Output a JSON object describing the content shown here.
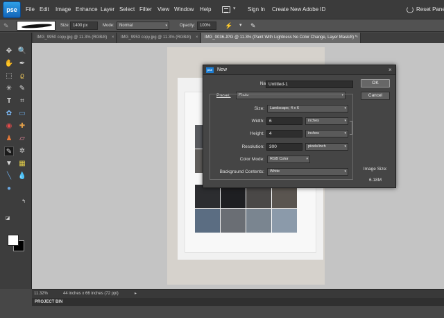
{
  "app": {
    "logo_text": "pse"
  },
  "menu": {
    "items": [
      "File",
      "Edit",
      "Image",
      "Enhance",
      "Layer",
      "Select",
      "Filter",
      "View",
      "Window",
      "Help"
    ],
    "sign_in": "Sign In",
    "create_id": "Create New Adobe ID",
    "reset_panels": "Reset Panels"
  },
  "options": {
    "size_label": "Size:",
    "size_value": "1400 px",
    "mode_label": "Mode:",
    "mode_value": "Normal",
    "opacity_label": "Opacity:",
    "opacity_value": "100%"
  },
  "tabs": [
    {
      "label": "IMG_9950 copy.jpg @ 11.3% (RGB/8)",
      "close": "×"
    },
    {
      "label": "IMG_9953 copy.jpg @ 11.3% (RGB/8)",
      "close": "×"
    },
    {
      "label": "IMG_0036.JPG @ 11.3% (Paint With Lightness No Color Change, Layer Mask/8) *",
      "close": "×"
    }
  ],
  "status": {
    "zoom": "11.32%",
    "doc_size": "44 inches x 66 inches (72 ppi)",
    "project_bin": "PROJECT BIN"
  },
  "dialog": {
    "title": "New",
    "close": "×",
    "name_label": "Name:",
    "name_value": "Untitled-1",
    "preset_label": "Preset:",
    "preset_value": "Photo",
    "size_label": "Size:",
    "size_value": "Landscape, 4 x 6",
    "width_label": "Width:",
    "width_value": "6",
    "width_unit": "inches",
    "height_label": "Height:",
    "height_value": "4",
    "height_unit": "inches",
    "resolution_label": "Resolution:",
    "resolution_value": "300",
    "resolution_unit": "pixels/inch",
    "color_mode_label": "Color Mode:",
    "color_mode_value": "RGB Color",
    "bg_contents_label": "Background Contents:",
    "bg_contents_value": "White",
    "ok": "OK",
    "cancel": "Cancel",
    "image_size_label": "Image Size:",
    "image_size_value": "6.18M"
  },
  "icons": {
    "move": "✥",
    "zoom": "🔍",
    "hand": "✋",
    "eyedropper": "✒",
    "marquee": "⬚",
    "lasso": "ϱ",
    "magic_wand": "✳",
    "quick_select": "✎",
    "type": "T",
    "crop": "⌗",
    "cookie_cutter": "✿",
    "recompose": "▭",
    "red_eye": "◉",
    "healing": "✚",
    "clone": "♟",
    "eraser": "▱",
    "brush": "✎",
    "smart_brush": "✲",
    "paint_bucket": "▼",
    "gradient": "▦",
    "shape": "╲",
    "blur": "💧",
    "sponge": "●",
    "swap": "↰",
    "default_colors": "◪"
  },
  "colors": {
    "accent": "#1e7fd4",
    "chrome": "#3b3b3b",
    "canvas": "#c4c4c4"
  }
}
